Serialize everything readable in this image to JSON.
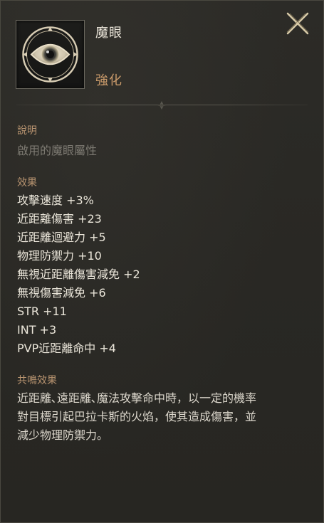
{
  "item": {
    "name": "魔眼",
    "grade": "強化",
    "icon": "eye-icon"
  },
  "close": {
    "icon": "close-icon"
  },
  "description": {
    "label": "說明",
    "text": "啟用的魔眼屬性"
  },
  "effects": {
    "label": "效果",
    "items": [
      "攻擊速度 +3%",
      "近距離傷害 +23",
      "近距離迴避力 +5",
      "物理防禦力 +10",
      "無視近距離傷害減免 +2",
      "無視傷害減免 +6",
      "STR +11",
      "INT +3",
      "PVP近距離命中 +4"
    ]
  },
  "resonance": {
    "label": "共鳴效果",
    "lines": [
      "近距離､遠距離､魔法攻擊命中時，以一定的機率",
      "對目標引起巴拉卡斯的火焰，使其造成傷害，並",
      "減少物理防禦力。"
    ]
  },
  "colors": {
    "background": "#2a2925",
    "heading": "#b89470",
    "grade": "#c99a6a",
    "text": "#ebe6da",
    "muted": "#7d7a72"
  }
}
